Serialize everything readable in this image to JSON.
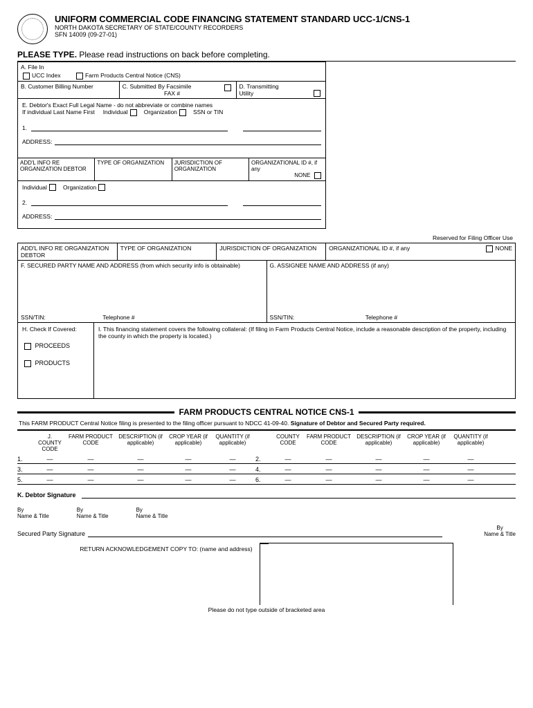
{
  "header": {
    "title": "UNIFORM COMMERCIAL CODE FINANCING STATEMENT STANDARD UCC-1/CNS-1",
    "subtitle": "NORTH DAKOTA SECRETARY OF STATE/COUNTY RECORDERS",
    "form_no": "SFN 14009 (09-27-01)"
  },
  "please_type": {
    "bold": "PLEASE TYPE.",
    "rest": "Please read instructions on back before completing."
  },
  "a": {
    "label": "A.  File In",
    "ucc": "UCC Index",
    "cns": "Farm Products Central Notice (CNS)"
  },
  "b": {
    "label": "B.  Customer Billing Number"
  },
  "c": {
    "label": "C.  Submitted By Facsimile",
    "fax": "FAX #"
  },
  "d": {
    "label": "D.  Transmitting",
    "utility": "Utility"
  },
  "e": {
    "label": "E.  Debtor's Exact Full Legal Name - do not abbreviate or combine names",
    "sub": "If individual Last Name First",
    "ind": "Individual",
    "org": "Organization",
    "ssn": "SSN or TIN",
    "addr": "ADDRESS:"
  },
  "org_info": {
    "c1": "ADD'L INFO RE ORGANIZATION DEBTOR",
    "c2": "TYPE OF ORGANIZATION",
    "c3": "JURISDICTION OF ORGANIZATION",
    "c4": "ORGANIZATIONAL ID #, if any",
    "none": "NONE"
  },
  "reserved": "Reserved for Filing Officer Use",
  "f": {
    "label": "F.  SECURED PARTY NAME AND ADDRESS (from which security info is obtainable)",
    "ssn": "SSN/TIN:",
    "tel": "Telephone #"
  },
  "g": {
    "label": "G.  ASSIGNEE NAME AND ADDRESS (if any)",
    "ssn": "SSN/TIN:",
    "tel": "Telephone #"
  },
  "h": {
    "label": "H. Check If Covered:",
    "proceeds": "PROCEEDS",
    "products": "PRODUCTS"
  },
  "i": {
    "label": "I.  This financing statement covers the following collateral:  (If filing in Farm Products Central Notice, include a reasonable description of the property, including the county in which the property is located.)"
  },
  "cns": {
    "title": "FARM PRODUCTS CENTRAL NOTICE CNS-1",
    "intro": "This FARM PRODUCT Central Notice filing is presented to the filing officer pursuant to NDCC 41-09-40.",
    "intro_bold": "Signature of Debtor and Secured Party required.",
    "cols": {
      "j": "J.  COUNTY CODE",
      "fp": "FARM PRODUCT CODE",
      "desc": "DESCRIPTION (if applicable)",
      "crop": "CROP YEAR (if applicable)",
      "qty": "QUANTITY (if applicable)",
      "county2": "COUNTY CODE"
    },
    "rows_left": [
      "1.",
      "3.",
      "5."
    ],
    "rows_right": [
      "2.",
      "4.",
      "6."
    ]
  },
  "k": {
    "label": "K.  Debtor Signature",
    "by": "By",
    "name_title": "Name & Title",
    "secured": "Secured Party Signature",
    "return": "RETURN ACKNOWLEDGEMENT COPY TO: (name and address)",
    "bottom": "Please do not type outside of bracketed area"
  }
}
